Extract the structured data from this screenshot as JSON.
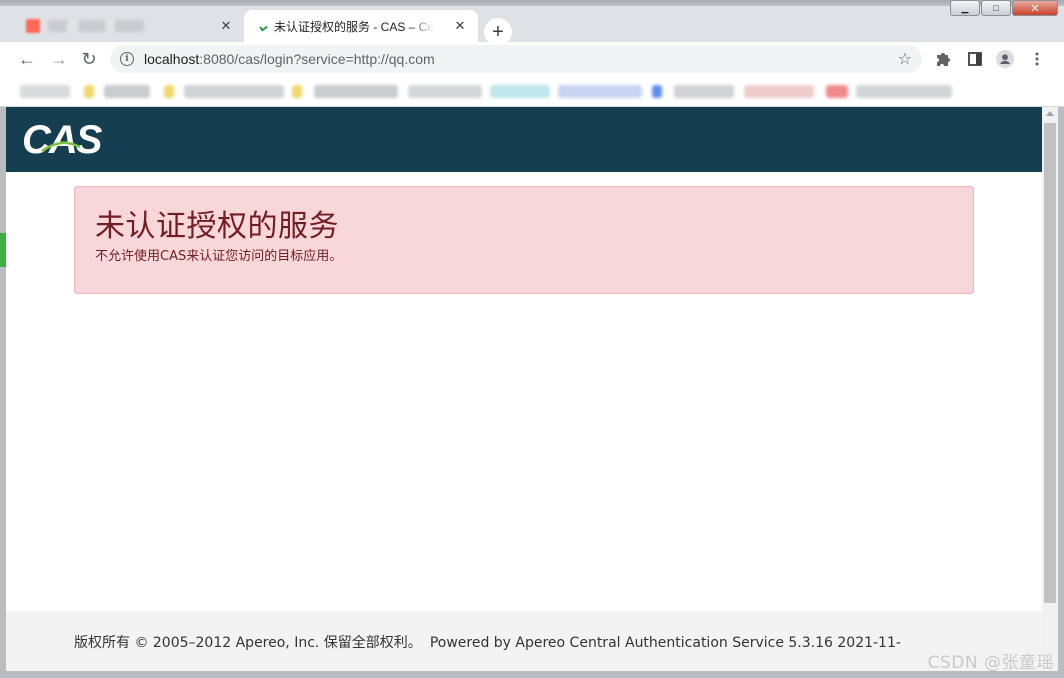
{
  "browser": {
    "tabs": [
      {
        "title": "",
        "close_glyph": "✕"
      },
      {
        "title": "未认证授权的服务 - CAS – Central Authentication Service",
        "close_glyph": "✕"
      }
    ],
    "new_tab_glyph": "+",
    "window_controls": {
      "minimize": "▁",
      "maximize": "□",
      "close": "✕"
    },
    "nav": {
      "back_icon": "←",
      "forward_icon": "→",
      "reload_icon": "↻"
    },
    "address": {
      "host": "localhost",
      "rest": ":8080/cas/login?service=http://qq.com"
    },
    "toolbar_icons": [
      "star-icon",
      "extensions-icon",
      "side-panel-icon",
      "profile-icon",
      "menu-icon"
    ]
  },
  "page": {
    "header": {
      "logo_text": "CAS"
    },
    "alert": {
      "heading": "未认证授权的服务",
      "message": "不允许使用CAS来认证您访问的目标应用。"
    },
    "footer": {
      "copyright": "版权所有 © 2005–2012 Apereo, Inc. 保留全部权利。",
      "powered": "Powered by Apereo Central Authentication Service 5.3.16 2021-11-"
    }
  },
  "watermark": "CSDN @张童瑶",
  "colors": {
    "header_bg": "#153e50",
    "alert_bg": "#f8d7da",
    "alert_text": "#721c24",
    "footer_bg": "#f3f3f3"
  }
}
